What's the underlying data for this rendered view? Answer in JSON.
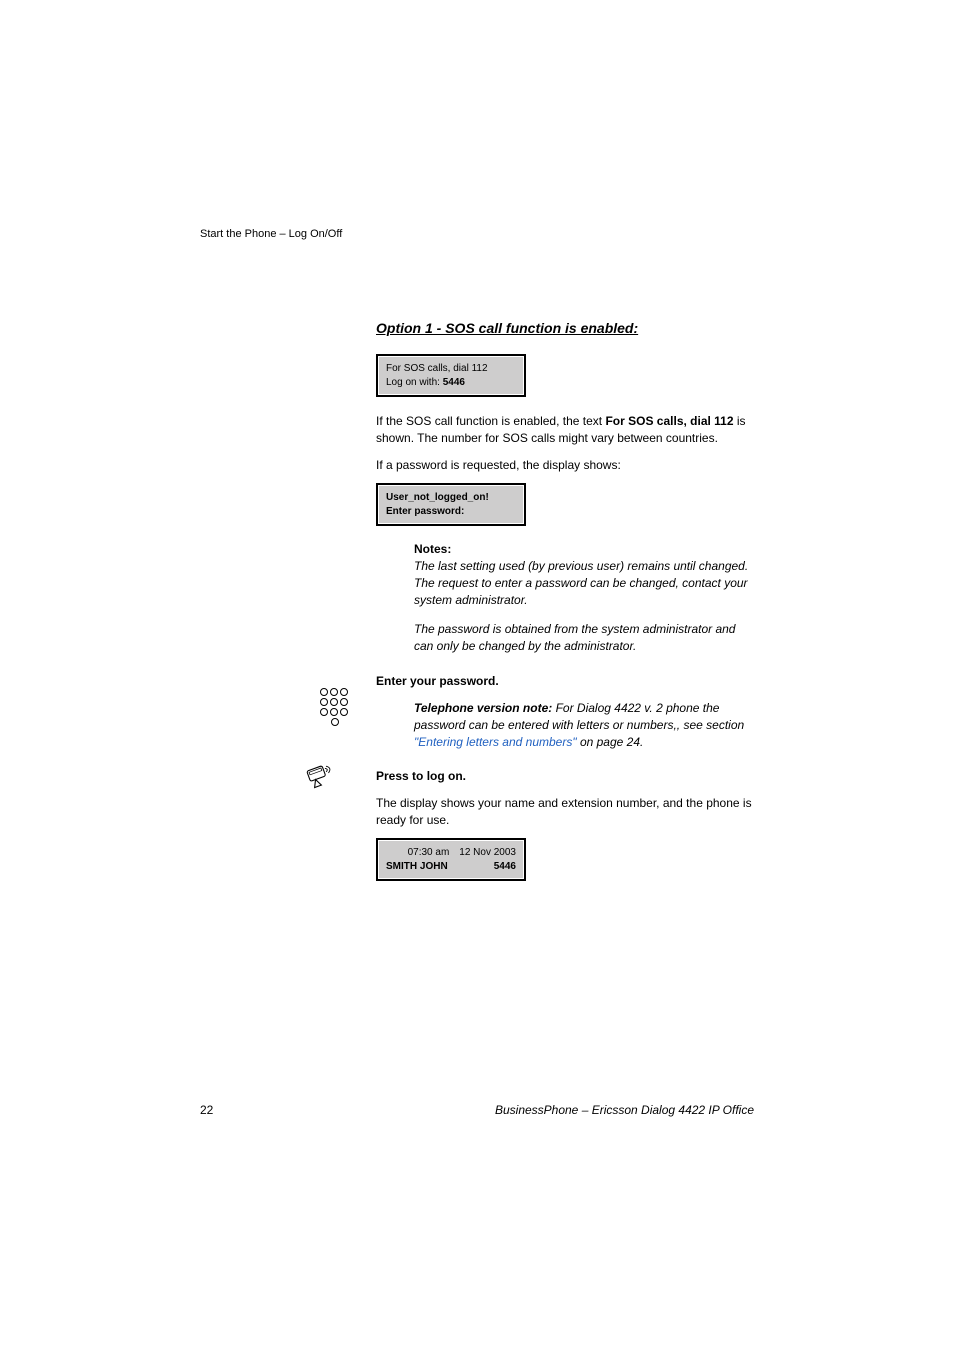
{
  "header": {
    "text": "Start the Phone – Log On/Off"
  },
  "heading": "Option 1 - SOS call function is enabled:",
  "display1": {
    "line1": "For SOS calls, dial 112",
    "line2_prefix": "Log on with: ",
    "line2_value": "5446"
  },
  "para1": {
    "prefix": "If the SOS call function is enabled, the text ",
    "bold": "For SOS calls, dial 112",
    "suffix": " is shown. The number for SOS calls might vary between countries."
  },
  "para2": "If a password is requested, the display shows:",
  "display2": {
    "line1": "User_not_logged_on!",
    "line2": "Enter password:"
  },
  "notes": {
    "label": "Notes:",
    "text1": "The last setting used (by previous user) remains until changed. The request to enter a password can be changed, contact your system administrator.",
    "text2": "The password is obtained from the system administrator and can only be changed by the administrator."
  },
  "action1": {
    "label": "Enter your password."
  },
  "version_note": {
    "bold": "Telephone version note:",
    "text": " For Dialog 4422 v. 2 phone the password can be entered with letters or numbers,, see section ",
    "link": "\"Entering letters and numbers\"",
    "suffix": " on page 24."
  },
  "action2": {
    "label": "Press to log on."
  },
  "para3": "The display shows your name and extension number, and the phone is ready for use.",
  "display3": {
    "time": "07:30 am",
    "date": "12 Nov 2003",
    "name": "SMITH JOHN",
    "ext": "5446"
  },
  "footer": {
    "page": "22",
    "right": "BusinessPhone – Ericsson Dialog 4422 IP Office"
  }
}
